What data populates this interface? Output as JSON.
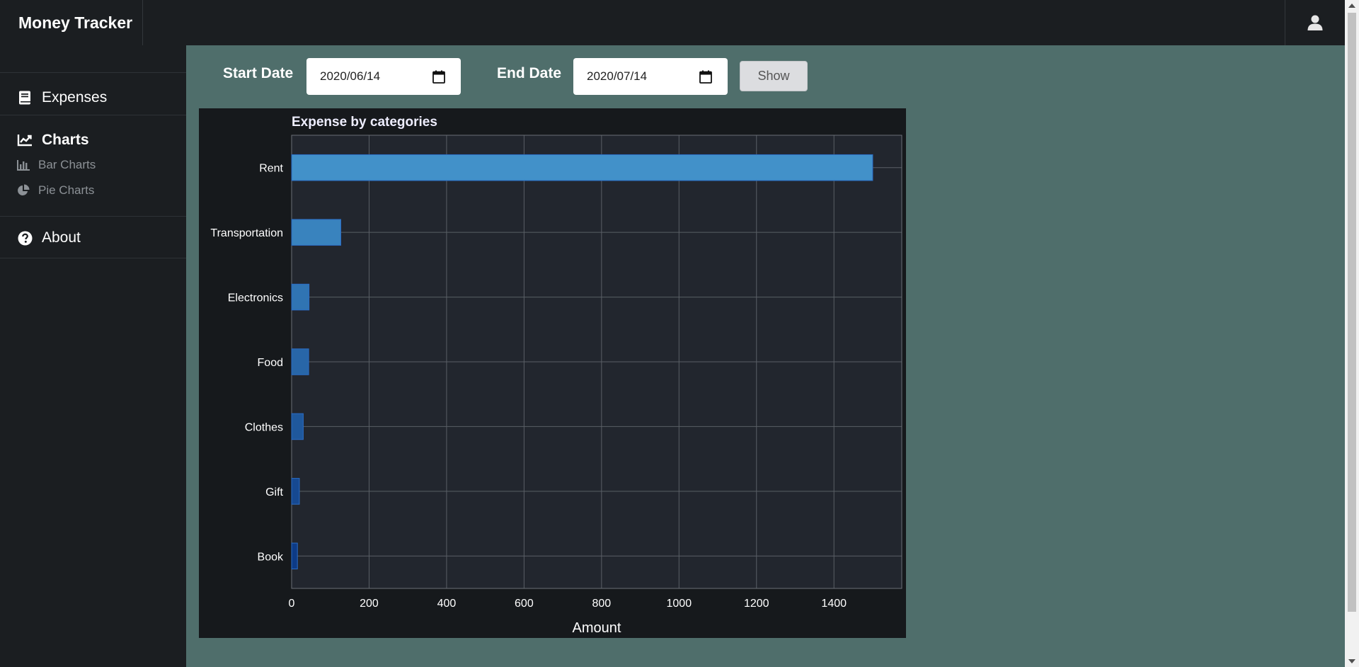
{
  "app": {
    "title": "Money Tracker"
  },
  "header": {
    "user_icon": "user-icon"
  },
  "sidebar": {
    "items": [
      {
        "label": "Expenses",
        "icon": "book-icon"
      },
      {
        "label": "Charts",
        "icon": "line-chart-icon",
        "active": true,
        "children": [
          {
            "label": "Bar Charts",
            "icon": "bar-chart-icon"
          },
          {
            "label": "Pie Charts",
            "icon": "pie-chart-icon"
          }
        ]
      },
      {
        "label": "About",
        "icon": "question-circle-icon"
      }
    ]
  },
  "filters": {
    "start_label": "Start Date",
    "start_value": "2020/06/14",
    "end_label": "End Date",
    "end_value": "2020/07/14",
    "show_label": "Show"
  },
  "colors": {
    "page_bg": "#4f6e6b",
    "sidebar_bg": "#1b1e21",
    "bar_light": "#4291c9",
    "bar_dark": "#0d3b86"
  },
  "chart_data": {
    "type": "bar",
    "orientation": "horizontal",
    "title": "Expense by categories",
    "xlabel": "Amount",
    "ylabel": "",
    "categories": [
      "Rent",
      "Transportation",
      "Electronics",
      "Food",
      "Clothes",
      "Gift",
      "Book"
    ],
    "values": [
      1500,
      127,
      45,
      44,
      30,
      20,
      15
    ],
    "xlim": [
      0,
      1575
    ],
    "xticks": [
      "0",
      "200",
      "400",
      "600",
      "800",
      "1000",
      "1200",
      "1400"
    ],
    "grid": true,
    "legend": "none"
  }
}
